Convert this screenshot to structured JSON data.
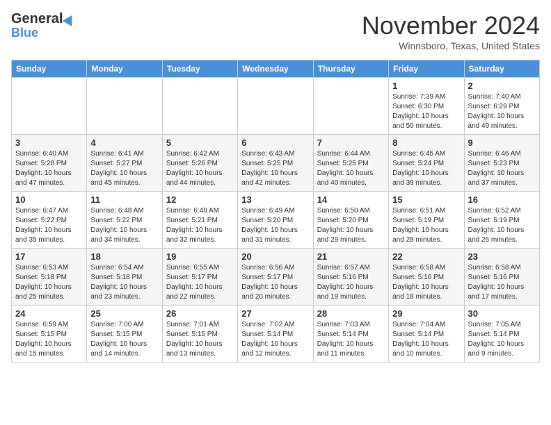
{
  "header": {
    "logo": {
      "general": "General",
      "blue": "Blue"
    },
    "month": "November 2024",
    "location": "Winnsboro, Texas, United States"
  },
  "weekdays": [
    "Sunday",
    "Monday",
    "Tuesday",
    "Wednesday",
    "Thursday",
    "Friday",
    "Saturday"
  ],
  "weeks": [
    [
      {
        "day": "",
        "info": ""
      },
      {
        "day": "",
        "info": ""
      },
      {
        "day": "",
        "info": ""
      },
      {
        "day": "",
        "info": ""
      },
      {
        "day": "",
        "info": ""
      },
      {
        "day": "1",
        "info": "Sunrise: 7:39 AM\nSunset: 6:30 PM\nDaylight: 10 hours and 50 minutes."
      },
      {
        "day": "2",
        "info": "Sunrise: 7:40 AM\nSunset: 6:29 PM\nDaylight: 10 hours and 49 minutes."
      }
    ],
    [
      {
        "day": "3",
        "info": "Sunrise: 6:40 AM\nSunset: 5:28 PM\nDaylight: 10 hours and 47 minutes."
      },
      {
        "day": "4",
        "info": "Sunrise: 6:41 AM\nSunset: 5:27 PM\nDaylight: 10 hours and 45 minutes."
      },
      {
        "day": "5",
        "info": "Sunrise: 6:42 AM\nSunset: 5:26 PM\nDaylight: 10 hours and 44 minutes."
      },
      {
        "day": "6",
        "info": "Sunrise: 6:43 AM\nSunset: 5:25 PM\nDaylight: 10 hours and 42 minutes."
      },
      {
        "day": "7",
        "info": "Sunrise: 6:44 AM\nSunset: 5:25 PM\nDaylight: 10 hours and 40 minutes."
      },
      {
        "day": "8",
        "info": "Sunrise: 6:45 AM\nSunset: 5:24 PM\nDaylight: 10 hours and 39 minutes."
      },
      {
        "day": "9",
        "info": "Sunrise: 6:46 AM\nSunset: 5:23 PM\nDaylight: 10 hours and 37 minutes."
      }
    ],
    [
      {
        "day": "10",
        "info": "Sunrise: 6:47 AM\nSunset: 5:22 PM\nDaylight: 10 hours and 35 minutes."
      },
      {
        "day": "11",
        "info": "Sunrise: 6:48 AM\nSunset: 5:22 PM\nDaylight: 10 hours and 34 minutes."
      },
      {
        "day": "12",
        "info": "Sunrise: 6:48 AM\nSunset: 5:21 PM\nDaylight: 10 hours and 32 minutes."
      },
      {
        "day": "13",
        "info": "Sunrise: 6:49 AM\nSunset: 5:20 PM\nDaylight: 10 hours and 31 minutes."
      },
      {
        "day": "14",
        "info": "Sunrise: 6:50 AM\nSunset: 5:20 PM\nDaylight: 10 hours and 29 minutes."
      },
      {
        "day": "15",
        "info": "Sunrise: 6:51 AM\nSunset: 5:19 PM\nDaylight: 10 hours and 28 minutes."
      },
      {
        "day": "16",
        "info": "Sunrise: 6:52 AM\nSunset: 5:19 PM\nDaylight: 10 hours and 26 minutes."
      }
    ],
    [
      {
        "day": "17",
        "info": "Sunrise: 6:53 AM\nSunset: 5:18 PM\nDaylight: 10 hours and 25 minutes."
      },
      {
        "day": "18",
        "info": "Sunrise: 6:54 AM\nSunset: 5:18 PM\nDaylight: 10 hours and 23 minutes."
      },
      {
        "day": "19",
        "info": "Sunrise: 6:55 AM\nSunset: 5:17 PM\nDaylight: 10 hours and 22 minutes."
      },
      {
        "day": "20",
        "info": "Sunrise: 6:56 AM\nSunset: 5:17 PM\nDaylight: 10 hours and 20 minutes."
      },
      {
        "day": "21",
        "info": "Sunrise: 6:57 AM\nSunset: 5:16 PM\nDaylight: 10 hours and 19 minutes."
      },
      {
        "day": "22",
        "info": "Sunrise: 6:58 AM\nSunset: 5:16 PM\nDaylight: 10 hours and 18 minutes."
      },
      {
        "day": "23",
        "info": "Sunrise: 6:58 AM\nSunset: 5:16 PM\nDaylight: 10 hours and 17 minutes."
      }
    ],
    [
      {
        "day": "24",
        "info": "Sunrise: 6:59 AM\nSunset: 5:15 PM\nDaylight: 10 hours and 15 minutes."
      },
      {
        "day": "25",
        "info": "Sunrise: 7:00 AM\nSunset: 5:15 PM\nDaylight: 10 hours and 14 minutes."
      },
      {
        "day": "26",
        "info": "Sunrise: 7:01 AM\nSunset: 5:15 PM\nDaylight: 10 hours and 13 minutes."
      },
      {
        "day": "27",
        "info": "Sunrise: 7:02 AM\nSunset: 5:14 PM\nDaylight: 10 hours and 12 minutes."
      },
      {
        "day": "28",
        "info": "Sunrise: 7:03 AM\nSunset: 5:14 PM\nDaylight: 10 hours and 11 minutes."
      },
      {
        "day": "29",
        "info": "Sunrise: 7:04 AM\nSunset: 5:14 PM\nDaylight: 10 hours and 10 minutes."
      },
      {
        "day": "30",
        "info": "Sunrise: 7:05 AM\nSunset: 5:14 PM\nDaylight: 10 hours and 9 minutes."
      }
    ]
  ]
}
